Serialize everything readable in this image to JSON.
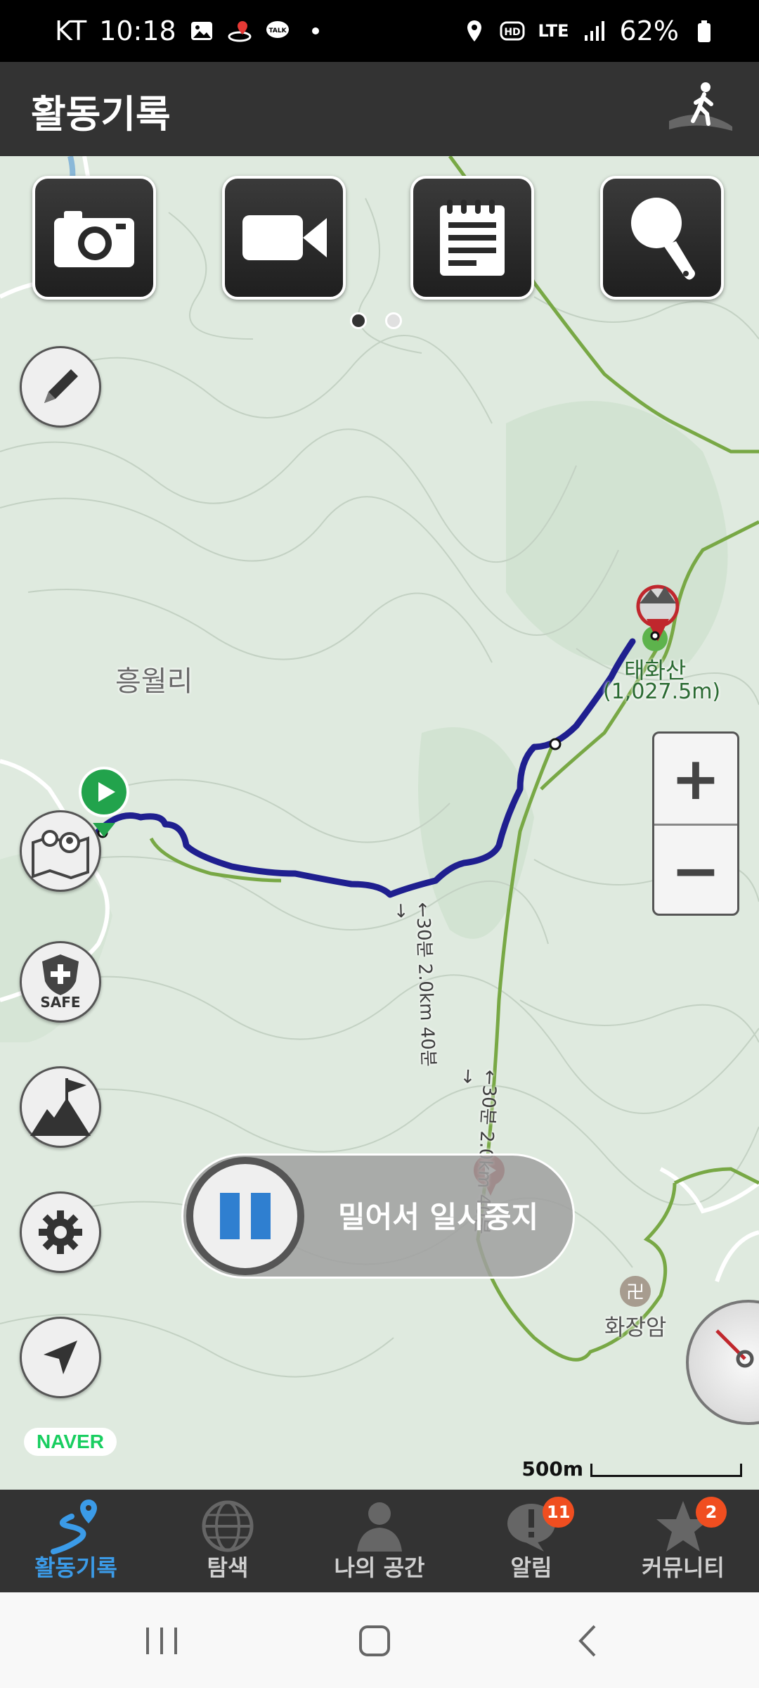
{
  "status_bar": {
    "carrier": "KT",
    "time": "10:18",
    "network": "LTE",
    "battery": "62%",
    "icons": [
      "gallery-icon",
      "map-pin-icon",
      "talk-icon",
      "dot-icon",
      "location-icon",
      "hd-icon",
      "lte-icon",
      "signal-icon",
      "battery-icon"
    ]
  },
  "header": {
    "title": "활동기록",
    "walk_icon": "walking-person-icon"
  },
  "toolbar": {
    "buttons": [
      {
        "icon": "camera-icon"
      },
      {
        "icon": "video-icon"
      },
      {
        "icon": "notepad-icon"
      },
      {
        "icon": "microphone-icon"
      }
    ],
    "page_dots": 2,
    "active_page": 1
  },
  "side_buttons": [
    "pencil-icon",
    "map-people-icon",
    "safe-shield-icon",
    "mountain-flag-icon",
    "gear-icon",
    "navigation-arrow-icon"
  ],
  "safe_label": "SAFE",
  "map": {
    "place_village": "흥월리",
    "peak_name": "태화산",
    "peak_elevation": "(1,027.5m)",
    "temple_name": "화장암",
    "trail_label_1": "←30분 2.0km 40분→",
    "trail_label_2": "←30분 2.0km 40분→",
    "zoom_in": "+",
    "zoom_out": "−",
    "scale": "500m",
    "provider": "NAVER"
  },
  "pause_slider": {
    "label": "밀어서 일시중지"
  },
  "tabs": [
    {
      "label": "활동기록",
      "icon": "activity-route-icon",
      "active": true
    },
    {
      "label": "탐색",
      "icon": "globe-icon",
      "active": false
    },
    {
      "label": "나의 공간",
      "icon": "person-icon",
      "active": false
    },
    {
      "label": "알림",
      "icon": "alert-bubble-icon",
      "active": false,
      "badge": "11"
    },
    {
      "label": "커뮤니티",
      "icon": "star-icon",
      "active": false,
      "badge": "2"
    }
  ],
  "colors": {
    "accent": "#3b9be8",
    "track": "#1f1f8f",
    "trail": "#78a845",
    "badge": "#f04e20"
  }
}
